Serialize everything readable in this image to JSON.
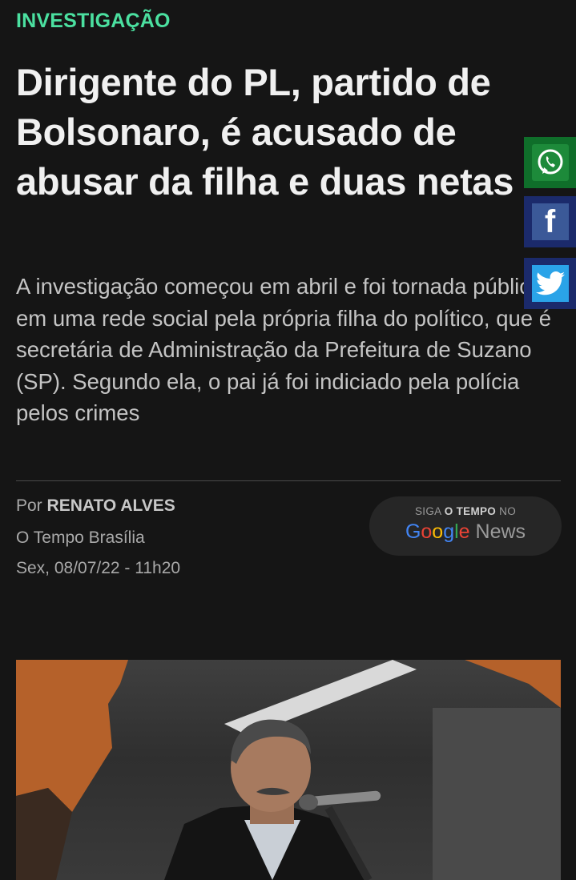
{
  "article": {
    "category": "INVESTIGAÇÃO",
    "headline": "Dirigente do PL, partido de Bolsonaro, é acusado de abusar da filha e duas netas",
    "summary": "A investigação começou em abril e foi tornada pública em uma rede social pela própria filha do político, que é secretária de Administração da Prefeitura de Suzano (SP). Segundo ela, o pai já foi indiciado pela polícia pelos crimes",
    "byline_prefix": "Por",
    "author": "RENATO ALVES",
    "outlet": "O Tempo Brasília",
    "date": "Sex, 08/07/22 - 11h20"
  },
  "google_news": {
    "siga": "SIGA",
    "brand": "O TEMPO",
    "no": "NO",
    "g1": "G",
    "g2": "o",
    "g3": "o",
    "g4": "g",
    "g5": "l",
    "g6": "e",
    "news": "News"
  },
  "share": {
    "whatsapp_icon": "whatsapp-icon",
    "facebook_icon": "facebook-icon",
    "twitter_icon": "twitter-icon",
    "facebook_glyph": "f",
    "whatsapp_color": "#1d8a3a",
    "facebook_color": "#3b5998",
    "twitter_color": "#2aa3e8"
  },
  "colors": {
    "background": "#151515",
    "kicker": "#4be0a0"
  }
}
